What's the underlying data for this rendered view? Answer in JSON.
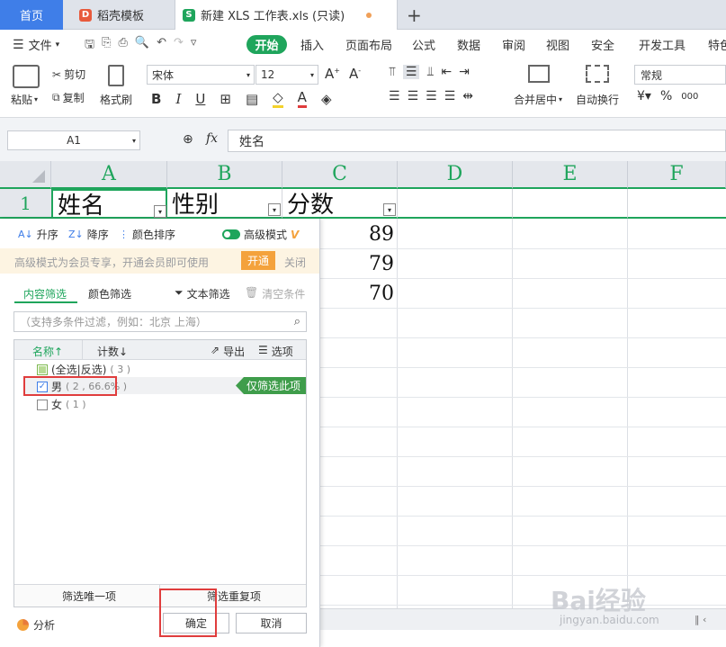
{
  "tabs": {
    "home": "首页",
    "template": "稻壳模板",
    "workbook": "新建 XLS 工作表.xls (只读)",
    "add": "+"
  },
  "menu": {
    "file": "文件",
    "items": [
      "开始",
      "插入",
      "页面布局",
      "公式",
      "数据",
      "审阅",
      "视图",
      "安全",
      "开发工具",
      "特色"
    ]
  },
  "ribbon": {
    "paste": "粘贴",
    "cut": "剪切",
    "copy": "复制",
    "format_painter": "格式刷",
    "font_name": "宋体",
    "font_size": "12",
    "merge": "合并居中",
    "wrap": "自动换行",
    "number_format": "常规",
    "percent": "%",
    "thousands": "000"
  },
  "formula": {
    "cell_ref": "A1",
    "fx": "fx",
    "content": "姓名"
  },
  "sheet": {
    "columns": [
      "A",
      "B",
      "C",
      "D",
      "E",
      "F"
    ],
    "row1_label": "1",
    "headers": [
      "姓名",
      "性别",
      "分数"
    ],
    "values": [
      "89",
      "79",
      "70"
    ]
  },
  "filter": {
    "sort_asc": "升序",
    "sort_desc": "降序",
    "sort_color": "颜色排序",
    "advanced_mode": "高级模式",
    "vip_mark": "V",
    "promo_text": "高级模式为会员专享，开通会员即可使用",
    "promo_open": "开通",
    "promo_close": "关闭",
    "tab_content": "内容筛选",
    "tab_color": "颜色筛选",
    "text_filter": "文本筛选",
    "clear": "清空条件",
    "search_placeholder": "（支持多条件过滤，例如：北京 上海）",
    "col_name": "名称↑",
    "col_count": "计数↓",
    "export": "导出",
    "options": "选项",
    "items": [
      {
        "label": "(全选|反选)",
        "count": "( 3 )"
      },
      {
        "label": "男",
        "count": "( 2 , 66.6% )"
      },
      {
        "label": "女",
        "count": "( 1 )"
      }
    ],
    "only_this": "仅筛选此项",
    "unique": "筛选唯一项",
    "duplicate": "筛选重复项",
    "analysis": "分析",
    "ok": "确定",
    "cancel": "取消"
  },
  "watermark": {
    "brand": "Bai经验",
    "url": "jingyan.baidu.com"
  },
  "colors": {
    "accent_green": "#1fa55c",
    "tab_blue": "#3f7ee8",
    "highlight_red": "#e03d3d",
    "promo_orange": "#f4a23c"
  }
}
